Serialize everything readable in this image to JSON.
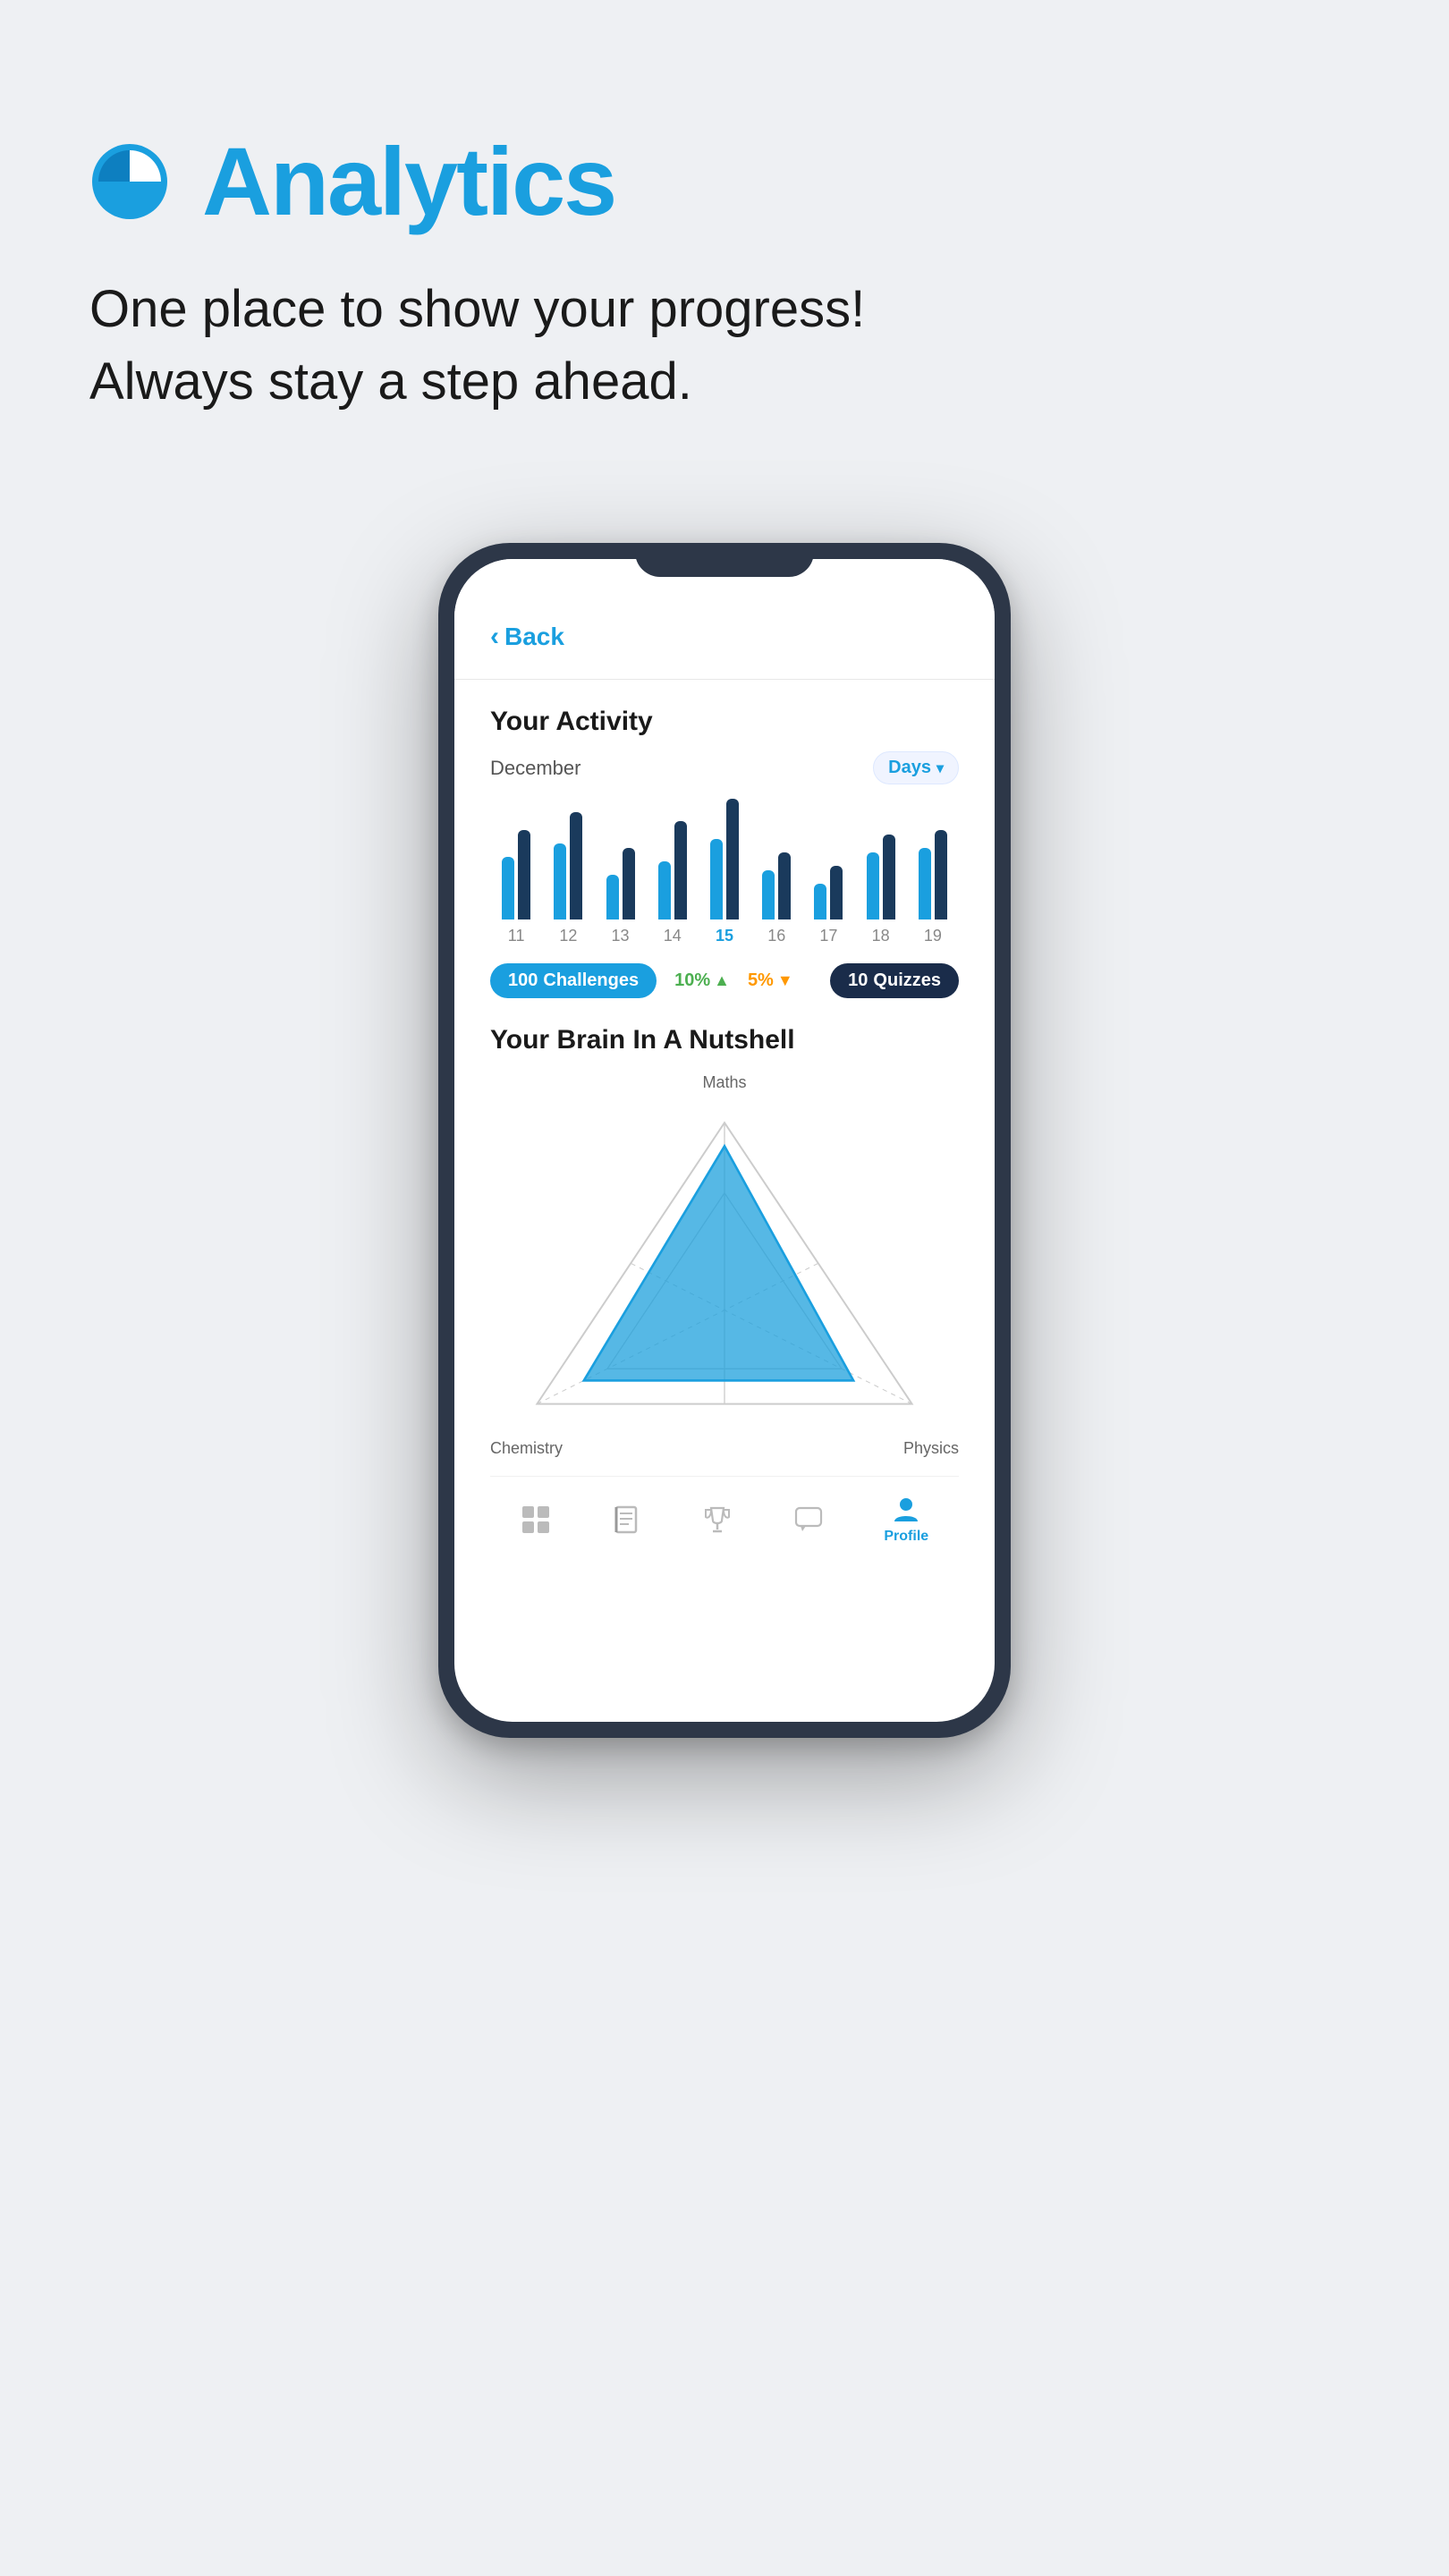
{
  "page": {
    "background": "#eef0f3"
  },
  "header": {
    "title": "Analytics",
    "subtitle_line1": "One place to show your progress!",
    "subtitle_line2": "Always stay a step ahead."
  },
  "phone": {
    "back_label": "Back",
    "activity": {
      "title": "Your Activity",
      "month": "December",
      "filter": "Days",
      "bars": [
        {
          "day": "11",
          "heights": [
            70,
            100
          ],
          "active": false
        },
        {
          "day": "12",
          "heights": [
            85,
            120
          ],
          "active": false
        },
        {
          "day": "13",
          "heights": [
            50,
            80
          ],
          "active": false
        },
        {
          "day": "14",
          "heights": [
            65,
            110
          ],
          "active": false
        },
        {
          "day": "15",
          "heights": [
            90,
            135
          ],
          "active": true
        },
        {
          "day": "16",
          "heights": [
            55,
            75
          ],
          "active": false
        },
        {
          "day": "17",
          "heights": [
            40,
            60
          ],
          "active": false
        },
        {
          "day": "18",
          "heights": [
            75,
            95
          ],
          "active": false
        },
        {
          "day": "19",
          "heights": [
            80,
            100
          ],
          "active": false
        }
      ],
      "badges": {
        "challenges_num": "100",
        "challenges_label": "Challenges",
        "percent1_val": "10%",
        "percent1_trend": "up",
        "percent2_val": "5%",
        "percent2_trend": "down",
        "quizzes_num": "10",
        "quizzes_label": "Quizzes"
      }
    },
    "brain": {
      "title": "Your Brain In A Nutshell",
      "label_top": "Maths",
      "label_left": "Chemistry",
      "label_right": "Physics"
    },
    "nav": {
      "items": [
        {
          "icon": "⊞",
          "label": "",
          "active": false
        },
        {
          "icon": "📖",
          "label": "",
          "active": false
        },
        {
          "icon": "🏆",
          "label": "",
          "active": false
        },
        {
          "icon": "💬",
          "label": "",
          "active": false
        },
        {
          "icon": "👤",
          "label": "Profile",
          "active": true
        }
      ]
    }
  }
}
